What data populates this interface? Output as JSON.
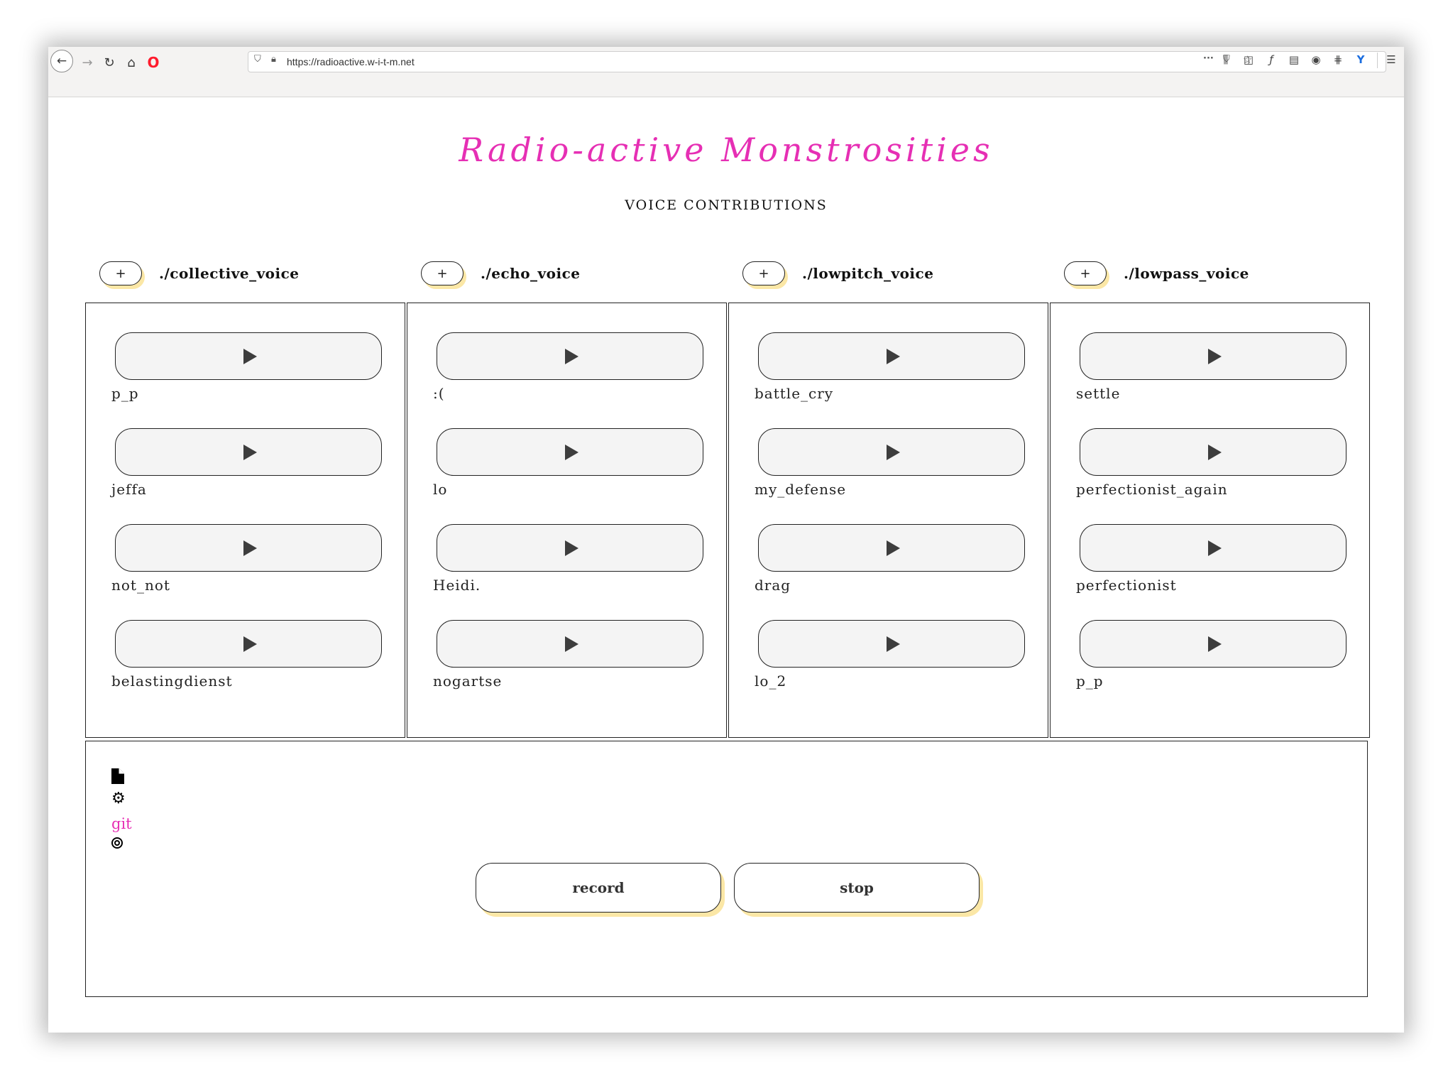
{
  "browser": {
    "url": "https://radioactive.w-i-t-m.net",
    "icons": [
      "back-icon",
      "forward-icon",
      "reload-icon",
      "home-icon",
      "opera-icon",
      "shield-icon",
      "lock-icon",
      "more-icon",
      "pocket-icon",
      "bookmark-star-icon",
      "library-icon",
      "sidebar-icon",
      "font-icon",
      "reader-icon",
      "account-icon",
      "extension-icon",
      "vpn-icon",
      "menu-icon"
    ]
  },
  "page": {
    "title": "Radio-active Monstrosities",
    "subtitle": "VOICE CONTRIBUTIONS",
    "accent_color": "#e62fb4",
    "shadow_color": "#fbe7a6"
  },
  "columns": [
    {
      "title": "./collective_voice",
      "add_label": "+",
      "clips": [
        "p_p",
        "jeffa",
        "not_not",
        "belastingdienst"
      ]
    },
    {
      "title": "./echo_voice",
      "add_label": "+",
      "clips": [
        ":(",
        "lo",
        "Heidi.",
        "nogartse"
      ]
    },
    {
      "title": "./lowpitch_voice",
      "add_label": "+",
      "clips": [
        "battle_cry",
        "my_defense",
        "drag",
        "lo_2"
      ]
    },
    {
      "title": "./lowpass_voice",
      "add_label": "+",
      "clips": [
        "settle",
        "perfectionist_again",
        "perfectionist",
        "p_p"
      ]
    }
  ],
  "footer": {
    "git_label": "git",
    "record_label": "record",
    "stop_label": "stop",
    "icons": [
      "document-icon",
      "gears-icon",
      "copyleft-icon"
    ]
  }
}
